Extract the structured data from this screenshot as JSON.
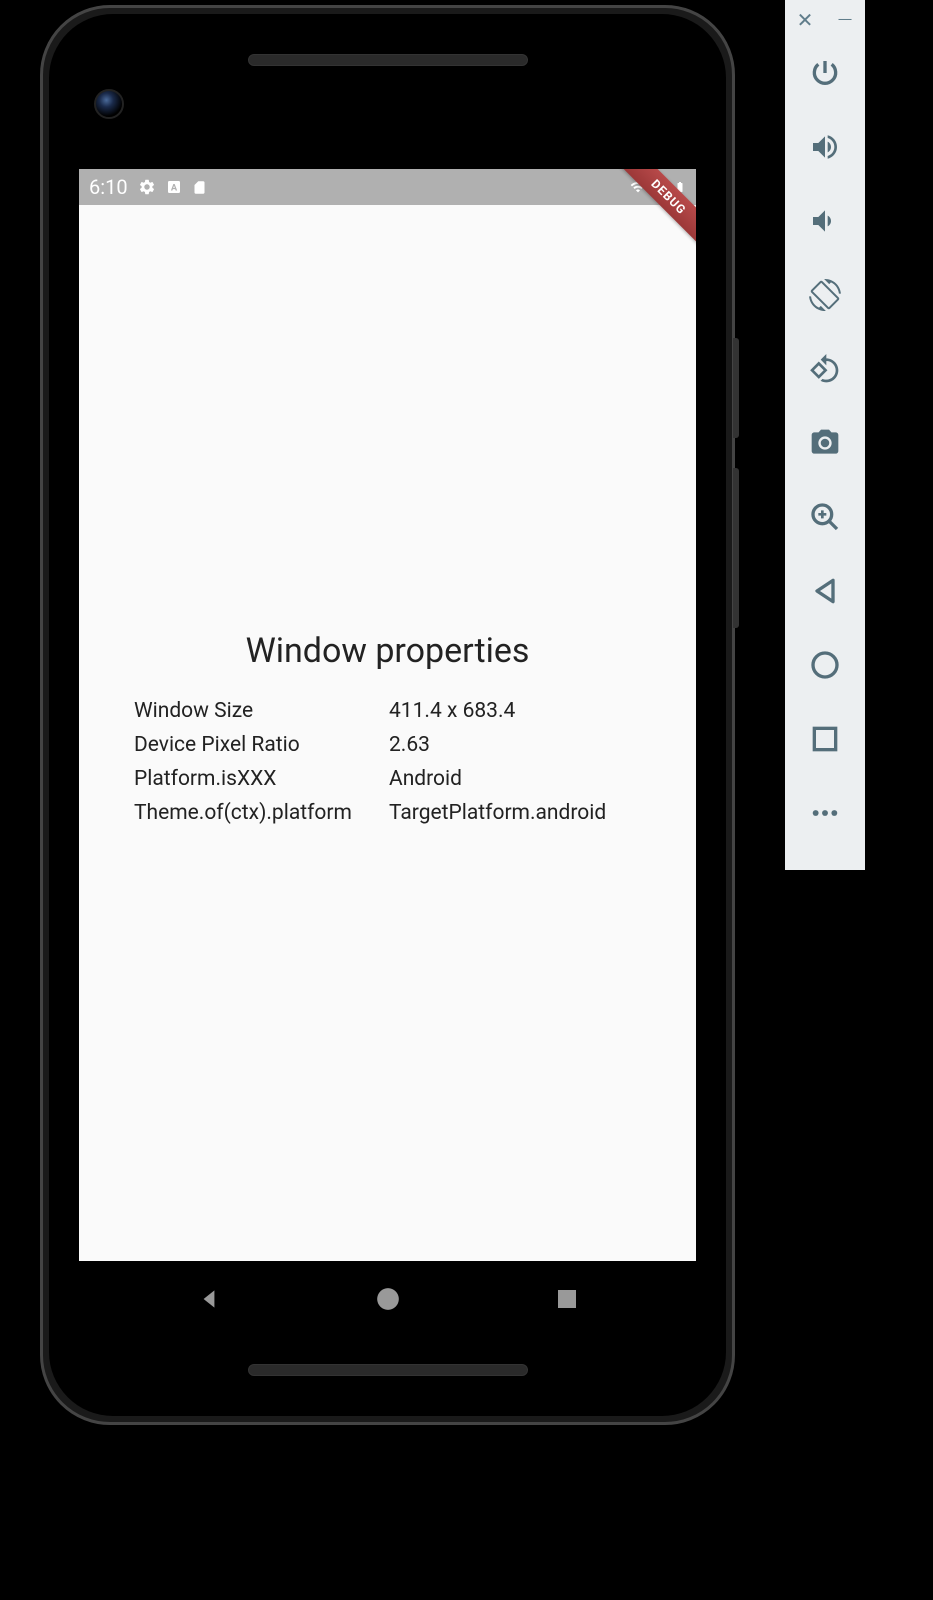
{
  "status_bar": {
    "time": "6:10"
  },
  "debug_banner": "DEBUG",
  "app": {
    "title": "Window properties",
    "properties": [
      {
        "label": "Window Size",
        "value": "411.4 x 683.4"
      },
      {
        "label": "Device Pixel Ratio",
        "value": "2.63"
      },
      {
        "label": "Platform.isXXX",
        "value": "Android"
      },
      {
        "label": "Theme.of(ctx).platform",
        "value": "TargetPlatform.android"
      }
    ]
  },
  "sidebar": {
    "close": "✕",
    "minimize": "—"
  }
}
